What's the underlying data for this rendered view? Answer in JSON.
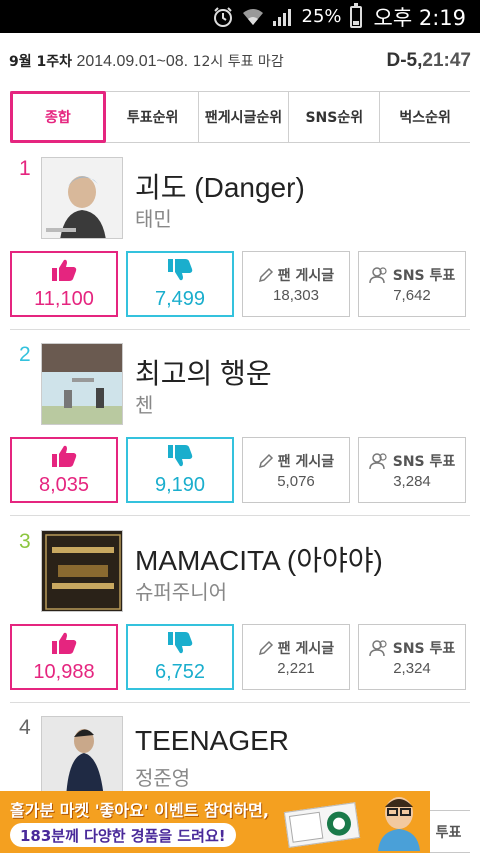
{
  "status_bar": {
    "icons": [
      "alarm-icon",
      "wifi-icon",
      "signal-icon",
      "battery-icon"
    ],
    "battery": "25%",
    "battery_level": 0.25,
    "time": "오후 2:19"
  },
  "header": {
    "week": "9월 1주차",
    "range": "2014.09.01~08.",
    "deadline": "12시 투표 마감",
    "dday_label": "D-5",
    "separator": ",",
    "countdown": "21:47"
  },
  "tabs": [
    {
      "label": "종합",
      "active": true
    },
    {
      "label": "투표순위",
      "active": false
    },
    {
      "label": "팬게시글순위",
      "active": false
    },
    {
      "label": "SNS순위",
      "active": false
    },
    {
      "label": "벅스순위",
      "active": false
    }
  ],
  "labels": {
    "fan_posts": "팬 게시글",
    "sns_votes": "SNS 투표"
  },
  "colors": {
    "accent": "#e5257f",
    "dislike": "#34c2dd",
    "rank1": "#e5257f",
    "rank2": "#34c2dd",
    "rank3": "#8cc63f",
    "rank4": "#666666"
  },
  "songs": [
    {
      "rank": "1",
      "title": "괴도 (Danger)",
      "artist": "태민",
      "likes": "11,100",
      "dislikes": "7,499",
      "fan_posts": "18,303",
      "sns_votes": "7,642"
    },
    {
      "rank": "2",
      "title": "최고의 행운",
      "artist": "첸",
      "likes": "8,035",
      "dislikes": "9,190",
      "fan_posts": "5,076",
      "sns_votes": "3,284"
    },
    {
      "rank": "3",
      "title": "MAMACITA (아야야)",
      "artist": "슈퍼주니어",
      "likes": "10,988",
      "dislikes": "6,752",
      "fan_posts": "2,221",
      "sns_votes": "2,324"
    },
    {
      "rank": "4",
      "title": "TEENAGER",
      "artist": "정준영"
    }
  ],
  "ad": {
    "line1": "홀가분 마켓 '좋아요' 이벤트 참여하면,",
    "line2": "183분께 다양한 경품을 드려요!",
    "peek_label": "투표"
  }
}
